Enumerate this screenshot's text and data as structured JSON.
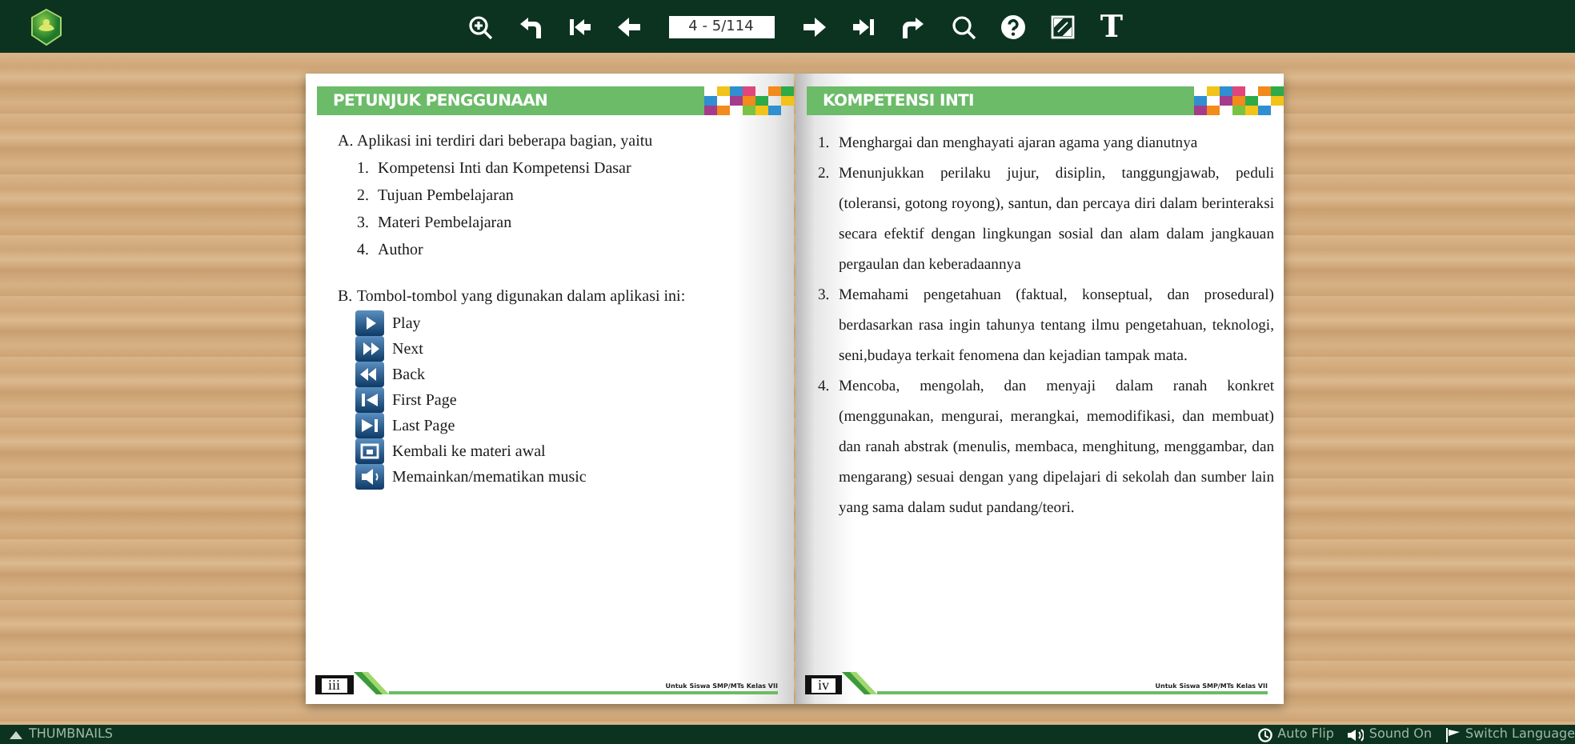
{
  "toolbar": {
    "tools_before": [
      {
        "kind": "zoom-in"
      },
      {
        "kind": "back"
      },
      {
        "kind": "first"
      },
      {
        "kind": "prev"
      }
    ],
    "page_field": "4 - 5/114",
    "tools_after": [
      {
        "kind": "next"
      },
      {
        "kind": "last"
      },
      {
        "kind": "forward"
      },
      {
        "kind": "search"
      },
      {
        "kind": "help"
      },
      {
        "kind": "fullscreen"
      },
      {
        "kind": "text",
        "label": "T"
      }
    ]
  },
  "left_page": {
    "header": "PETUNJUK PENGGUNAAN",
    "section_a": {
      "label": "A.",
      "text": "Aplikasi ini terdiri dari beberapa bagian, yaitu"
    },
    "parts": [
      {
        "number": "1.",
        "text": "Kompetensi Inti dan Kompetensi Dasar"
      },
      {
        "number": "2.",
        "text": "Tujuan Pembelajaran"
      },
      {
        "number": "3.",
        "text": "Materi Pembelajaran"
      },
      {
        "number": "4.",
        "text": "Author"
      }
    ],
    "section_b": {
      "label": "B.",
      "text": "Tombol-tombol yang digunakan dalam aplikasi ini:"
    },
    "buttons": [
      {
        "kind": "play",
        "text": "Play"
      },
      {
        "kind": "next",
        "text": "Next"
      },
      {
        "kind": "back",
        "text": "Back"
      },
      {
        "kind": "first",
        "text": "First Page"
      },
      {
        "kind": "last",
        "text": "Last Page"
      },
      {
        "kind": "home",
        "text": "Kembali ke materi awal"
      },
      {
        "kind": "music",
        "text": "Memainkan/mematikan music"
      }
    ],
    "page_number": "iii",
    "footer": "Untuk Siswa SMP/MTs Kelas VII"
  },
  "right_page": {
    "header": "KOMPETENSI INTI",
    "items": [
      {
        "number": "1.",
        "text": "Menghargai dan menghayati ajaran agama yang dianutnya"
      },
      {
        "number": "2.",
        "text": "Menunjukkan perilaku jujur, disiplin, tanggungjawab, peduli (toleransi, gotong royong), santun, dan percaya diri dalam berinteraksi secara efektif  dengan lingkungan sosial dan alam dalam jangkauan pergaulan dan keberadaannya"
      },
      {
        "number": "3.",
        "text": "Memahami pengetahuan (faktual, konseptual, dan prosedural) berdasarkan rasa ingin tahunya tentang ilmu pengetahuan, teknologi, seni,budaya terkait fenomena dan kejadian tampak mata."
      },
      {
        "number": "4.",
        "text": "Mencoba, mengolah, dan menyaji dalam ranah konkret (menggunakan, mengurai, merangkai, memodifikasi, dan membuat) dan ranah abstrak (menulis, membaca, menghitung, menggambar, dan mengarang) sesuai dengan yang dipelajari di sekolah dan sumber lain yang sama dalam sudut pandang/teori."
      }
    ],
    "page_number": "iv",
    "footer": "Untuk Siswa SMP/MTs Kelas VII"
  },
  "bottom_bar": {
    "thumbnails": "THUMBNAILS",
    "auto_flip": "Auto Flip",
    "sound": "Sound On",
    "language": "Switch Language"
  }
}
